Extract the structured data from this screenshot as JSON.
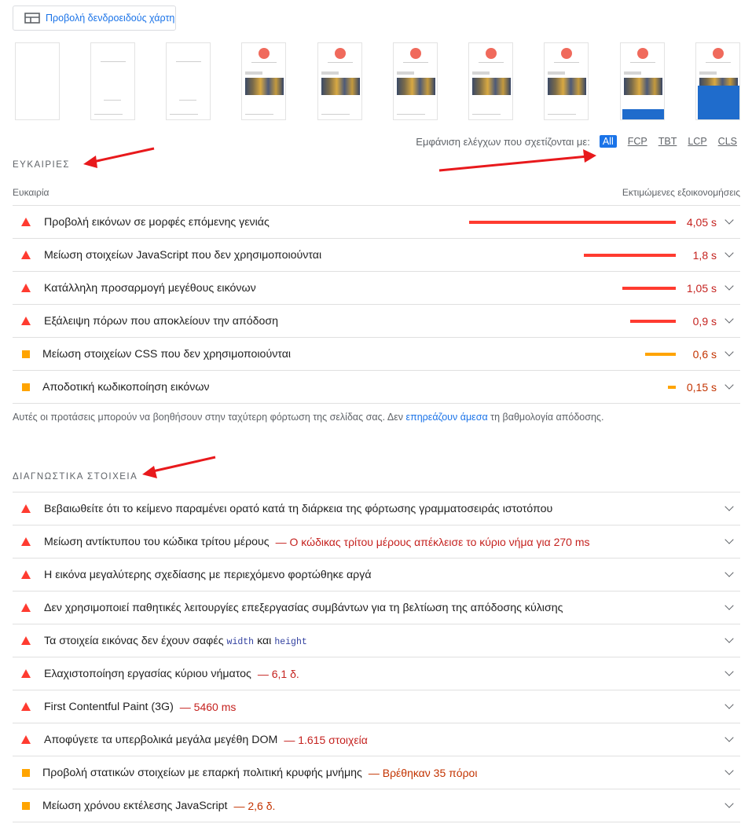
{
  "treemap": {
    "label": "Προβολή δενδροειδούς χάρτη",
    "icon": "treemap-icon"
  },
  "filmstrip": {
    "frame_count": 10,
    "frame_text_top": "Αρχική · Νέα · Επαφή",
    "frame_text_bottom": "Αρθρογράφοι ..."
  },
  "filter": {
    "label": "Εμφάνιση ελέγχων που σχετίζονται με:",
    "chips": [
      "All",
      "FCP",
      "TBT",
      "LCP",
      "CLS"
    ],
    "active": "All"
  },
  "opportunities": {
    "section_title": "ΕΥΚΑΙΡΙΕΣ",
    "col_left": "Ευκαιρία",
    "col_right": "Εκτιμώμενες εξοικονομήσεις",
    "items": [
      {
        "severity": "fail",
        "title": "Προβολή εικόνων σε μορφές επόμενης γενιάς",
        "value": "4,05 s",
        "savings": 4.05
      },
      {
        "severity": "fail",
        "title": "Μείωση στοιχείων JavaScript που δεν χρησιμοποιούνται",
        "value": "1,8 s",
        "savings": 1.8
      },
      {
        "severity": "fail",
        "title": "Κατάλληλη προσαρμογή μεγέθους εικόνων",
        "value": "1,05 s",
        "savings": 1.05
      },
      {
        "severity": "fail",
        "title": "Εξάλειψη πόρων που αποκλείουν την απόδοση",
        "value": "0,9 s",
        "savings": 0.9
      },
      {
        "severity": "average",
        "title": "Μείωση στοιχείων CSS που δεν χρησιμοποιούνται",
        "value": "0,6 s",
        "savings": 0.6
      },
      {
        "severity": "average",
        "title": "Αποδοτική κωδικοποίηση εικόνων",
        "value": "0,15 s",
        "savings": 0.15
      }
    ],
    "footnote_before": "Αυτές οι προτάσεις μπορούν να βοηθήσουν στην ταχύτερη φόρτωση της σελίδας σας. Δεν ",
    "footnote_link": "επηρεάζουν άμεσα",
    "footnote_after": " τη βαθμολογία απόδοσης."
  },
  "diagnostics": {
    "section_title": "ΔΙΑΓΝΩΣΤΙΚΑ ΣΤΟΙΧΕΙΑ",
    "items": [
      {
        "severity": "fail",
        "title": "Βεβαιωθείτε ότι το κείμενο παραμένει ορατό κατά τη διάρκεια της φόρτωσης γραμματοσειράς ιστοτόπου",
        "detail": ""
      },
      {
        "severity": "fail",
        "title": "Μείωση αντίκτυπου του κώδικα τρίτου μέρους",
        "detail": "— Ο κώδικας τρίτου μέρους απέκλεισε το κύριο νήμα για 270 ms"
      },
      {
        "severity": "fail",
        "title": "Η εικόνα μεγαλύτερης σχεδίασης με περιεχόμενο φορτώθηκε αργά",
        "detail": ""
      },
      {
        "severity": "fail",
        "title": "Δεν χρησιμοποιεί παθητικές λειτουργίες επεξεργασίας συμβάντων για τη βελτίωση της απόδοσης κύλισης",
        "detail": ""
      },
      {
        "severity": "fail",
        "title_before": "Τα στοιχεία εικόνας δεν έχουν σαφές",
        "code1": "width",
        "title_mid": "και",
        "code2": "height",
        "detail": ""
      },
      {
        "severity": "fail",
        "title": "Ελαχιστοποίηση εργασίας κύριου νήματος",
        "detail": "— 6,1 δ."
      },
      {
        "severity": "fail",
        "title": "First Contentful Paint (3G)",
        "detail": "— 5460 ms"
      },
      {
        "severity": "fail",
        "title": "Αποφύγετε τα υπερβολικά μεγάλα μεγέθη DOM",
        "detail": "— 1.615 στοιχεία"
      },
      {
        "severity": "average",
        "title": "Προβολή στατικών στοιχείων με επαρκή πολιτική κρυφής μνήμης",
        "detail": "— Βρέθηκαν 35 πόροι"
      },
      {
        "severity": "average",
        "title": "Μείωση χρόνου εκτέλεσης JavaScript",
        "detail": "— 2,6 δ."
      }
    ]
  },
  "colors": {
    "fail": "#ff3b30",
    "average": "#ffa400",
    "fail_text": "#c5221f",
    "average_text": "#c33300",
    "link": "#1a73e8",
    "annotation_arrow": "#e8191c"
  }
}
